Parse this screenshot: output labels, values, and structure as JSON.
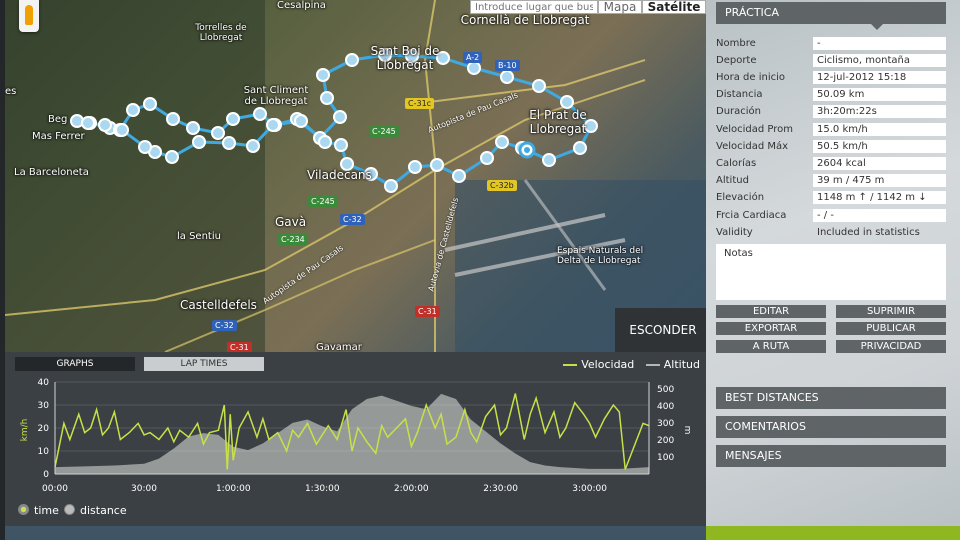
{
  "map": {
    "search_placeholder": "Introduce lugar que buscar",
    "type_map": "Mapa",
    "type_satellite": "Satélite",
    "hide_button": "ESCONDER",
    "places": [
      "Cesalpina",
      "Torrelles de Llobregat",
      "Cornellà de Llobregat",
      "Sant Boi de Llobregat",
      "Sant Climent de Llobregat",
      "Beg",
      "Mas Ferrer",
      "La Barceloneta",
      "Viladecans",
      "Gavà",
      "la Sentiu",
      "El Prat de Llobregat",
      "Espais Naturals del Delta de Llobregat",
      "Castelldefels",
      "Gavamar",
      "es"
    ],
    "roads": [
      "A-2",
      "B-10",
      "C-31c",
      "C-245",
      "C-245",
      "C-32",
      "C-234",
      "C-32b",
      "C-32",
      "C-31",
      "C-31"
    ],
    "road_names": [
      "Autopista de Pau Casals",
      "Autopista de Pau Casals",
      "Autovia de Castelldefels"
    ]
  },
  "graph": {
    "tab_graphs": "GRAPHS",
    "tab_laps": "LAP TIMES",
    "legend_speed": "Velocidad",
    "legend_alt": "Altitud",
    "radio_time": "time",
    "radio_distance": "distance",
    "speed_color": "#c8e048",
    "alt_color": "#b4b8b4"
  },
  "chart_data": {
    "type": "line",
    "x_ticks": [
      "00:00",
      "30:00",
      "1:00:00",
      "1:30:00",
      "2:00:00",
      "2:30:00",
      "3:00:00"
    ],
    "y_left_label": "km/h",
    "y_left_ticks": [
      0,
      10,
      20,
      30,
      40
    ],
    "y_left_lim": [
      0,
      40
    ],
    "y_right_label": "m",
    "y_right_ticks": [
      100,
      200,
      300,
      400,
      500
    ],
    "y_right_lim": [
      0,
      540
    ],
    "x_lim": [
      0,
      200
    ],
    "series": [
      {
        "name": "Velocidad",
        "axis": "left",
        "x": [
          0,
          3,
          5,
          8,
          10,
          12,
          14,
          16,
          18,
          20,
          22,
          25,
          28,
          30,
          32,
          35,
          38,
          40,
          42,
          45,
          48,
          50,
          52,
          55,
          57,
          58,
          59,
          60,
          62,
          65,
          68,
          70,
          72,
          75,
          78,
          80,
          82,
          85,
          88,
          90,
          92,
          95,
          98,
          100,
          102,
          105,
          108,
          110,
          112,
          115,
          118,
          120,
          122,
          125,
          128,
          130,
          132,
          135,
          138,
          140,
          142,
          145,
          148,
          150,
          152,
          155,
          158,
          160,
          162,
          165,
          168,
          170,
          172,
          175,
          178,
          180,
          182,
          185,
          188,
          190,
          192,
          195,
          198,
          200
        ],
        "y": [
          3,
          22,
          15,
          26,
          18,
          20,
          28,
          17,
          20,
          27,
          15,
          18,
          22,
          17,
          18,
          15,
          20,
          14,
          19,
          16,
          22,
          13,
          18,
          19,
          30,
          2,
          26,
          6,
          20,
          27,
          16,
          24,
          15,
          18,
          10,
          19,
          16,
          22,
          13,
          17,
          21,
          15,
          28,
          10,
          20,
          14,
          9,
          21,
          16,
          20,
          24,
          12,
          18,
          30,
          20,
          26,
          13,
          16,
          28,
          18,
          14,
          25,
          30,
          17,
          20,
          35,
          15,
          26,
          33,
          18,
          27,
          16,
          20,
          31,
          26,
          22,
          16,
          24,
          30,
          27,
          2,
          12,
          22,
          21
        ]
      },
      {
        "name": "Altitud",
        "axis": "right",
        "x": [
          0,
          10,
          20,
          30,
          35,
          40,
          45,
          50,
          55,
          60,
          65,
          70,
          75,
          80,
          85,
          90,
          95,
          100,
          105,
          110,
          115,
          120,
          125,
          130,
          135,
          140,
          145,
          150,
          155,
          160,
          165,
          170,
          175,
          180,
          185,
          190,
          195,
          200
        ],
        "y": [
          40,
          45,
          50,
          60,
          90,
          150,
          220,
          240,
          230,
          160,
          140,
          180,
          240,
          300,
          320,
          280,
          250,
          380,
          440,
          460,
          430,
          400,
          380,
          470,
          440,
          320,
          250,
          180,
          120,
          70,
          50,
          40,
          35,
          30,
          30,
          30,
          35,
          40
        ]
      }
    ]
  },
  "panel": {
    "title": "PRÁCTICA",
    "rows": [
      {
        "label": "Nombre",
        "value": "-"
      },
      {
        "label": "Deporte",
        "value": "Ciclismo, montaña"
      },
      {
        "label": "Hora de inicio",
        "value": "12-jul-2012 15:18"
      },
      {
        "label": "Distancia",
        "value": "50.09 km"
      },
      {
        "label": "Duración",
        "value": "3h:20m:22s"
      },
      {
        "label": "Velocidad Prom",
        "value": "15.0 km/h"
      },
      {
        "label": "Velocidad Máx",
        "value": "50.5 km/h"
      },
      {
        "label": "Calorías",
        "value": "2604 kcal"
      },
      {
        "label": "Altitud",
        "value": "39 m / 475 m"
      },
      {
        "label": "Elevación",
        "value": "1148 m ↑ / 1142 m ↓"
      },
      {
        "label": "Frcia Cardiaca",
        "value": "- / -"
      },
      {
        "label": "Validity",
        "value": "Included in statistics"
      }
    ],
    "notes": "Notas",
    "btn_edit": "EDITAR",
    "btn_delete": "SUPRIMIR",
    "btn_export": "EXPORTAR",
    "btn_publish": "PUBLICAR",
    "btn_route": "A RUTA",
    "btn_privacy": "PRIVACIDAD",
    "best_distances": "BEST DISTANCES",
    "comments": "COMENTARIOS",
    "messages": "MENSAJES"
  }
}
